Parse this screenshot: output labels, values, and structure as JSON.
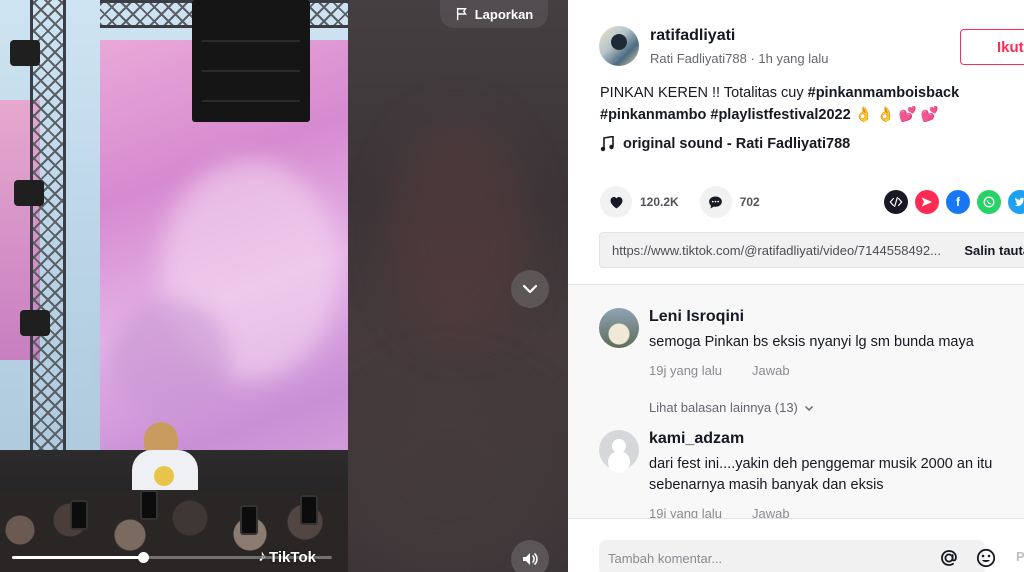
{
  "video": {
    "report_label": "Laporkan",
    "watermark": "TikTok",
    "progress": 0.41
  },
  "author": {
    "username": "ratifadliyati",
    "display_name": "Rati Fadliyati788",
    "time": "1h yang lalu",
    "subline": "Rati Fadliyati788 · 1h yang lalu",
    "follow_label": "Ikuti"
  },
  "caption": {
    "text_prefix": "PINKAN KEREN !! Totalitas cuy ",
    "tag1": "#pinkanmamboisback",
    "tag2": "#pinkanmambo",
    "tag3": "#playlistfestival2022",
    "emojis": "👌 👌 💕 💕"
  },
  "music": {
    "label": "original sound - Rati Fadliyati788"
  },
  "stats": {
    "likes": "120.2K",
    "comments": "702"
  },
  "share": {
    "link": "https://www.tiktok.com/@ratifadliyati/video/7144558492...",
    "copy_label": "Salin tautan"
  },
  "comments": [
    {
      "name": "Leni Isroqini",
      "text": "semoga Pinkan bs eksis nyanyi lg sm bunda maya",
      "time": "19j yang lalu",
      "reply": "Jawab",
      "more_replies": "Lihat balasan lainnya (13)"
    },
    {
      "name": "kami_adzam",
      "text": "dari fest ini....yakin deh penggemar musik 2000 an itu sebenarnya masih banyak dan eksis",
      "time": "19j yang lalu",
      "reply": "Jawab"
    }
  ],
  "compose": {
    "placeholder": "Tambah komentar...",
    "post_label": "Posting"
  },
  "colors": {
    "accent": "#fe2c55",
    "whatsapp": "#25d366",
    "facebook": "#1877f2",
    "twitter": "#1da1f2",
    "embed": "#161823"
  }
}
